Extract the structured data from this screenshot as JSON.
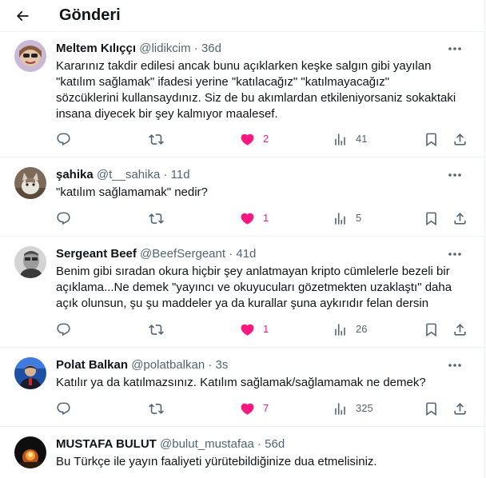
{
  "header": {
    "title": "Gönderi",
    "back_icon": "arrow-left-icon"
  },
  "colors": {
    "like": "#f91880",
    "muted": "#536471",
    "text": "#0f1419",
    "divider": "#eff3f4"
  },
  "tweets": [
    {
      "name": "Meltem Kılıççı",
      "handle": "@lidikcim",
      "dot": "·",
      "time": "36d",
      "text": "Kararınız takdir edilesi ancak bunu açıklarken keşke salgın gibi yayılan\n\"katılım sağlamak\" ifadesi yerine \"katılacağız\"  \"katılmayacağız\"\nsözcüklerini kullansaydınız. Siz de bu akımlardan etkileniyorsaniz sokaktaki\ninsana diyecek bir şey kalmıyor maalesef.",
      "likes": "2",
      "views": "41",
      "liked": true
    },
    {
      "name": "şahika",
      "handle": "@t__sahika",
      "dot": "·",
      "time": "11d",
      "text": "\"katılım sağlamamak\" nedir?",
      "likes": "1",
      "views": "5",
      "liked": true
    },
    {
      "name": "Sergeant Beef",
      "handle": "@BeefSergeant",
      "dot": "·",
      "time": "41d",
      "text": "Benim gibi sıradan okura hiçbir şey anlatmayan kripto cümlelerle bezeli bir\naçıklama...Ne demek \"yayıncı ve okuyucuları gözetmekten uzaklaştı\" daha\naçık olunsun, şu şu maddeler ya da kurallar şuna aykırıdır felan dersin",
      "likes": "1",
      "views": "26",
      "liked": true
    },
    {
      "name": "Polat Balkan",
      "handle": "@polatbalkan",
      "dot": "·",
      "time": "3s",
      "text": "Katılır ya da katılmazsınız. Katılım sağlamak/sağlamamak ne demek?",
      "likes": "7",
      "views": "325",
      "liked": true
    },
    {
      "name": "MUSTAFA BULUT",
      "handle": "@bulut_mustafaa",
      "dot": "·",
      "time": "56d",
      "text": "Bu Türkçe ile yayın faaliyeti yürütebildiğinize dua etmelisiniz."
    }
  ]
}
